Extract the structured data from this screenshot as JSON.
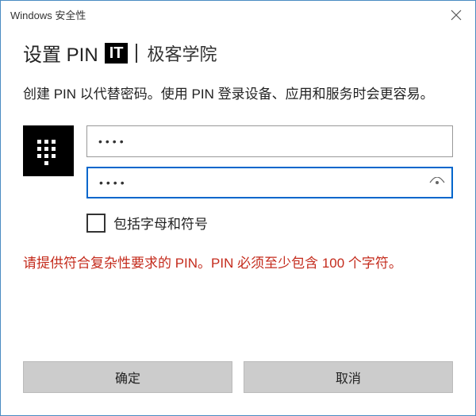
{
  "titlebar": {
    "title": "Windows 安全性"
  },
  "heading": "设置 PIN",
  "brand": {
    "badge": "IT",
    "text": "极客学院"
  },
  "description": "创建 PIN 以代替密码。使用 PIN 登录设备、应用和服务时会更容易。",
  "pin": {
    "value1": "••••",
    "value2": "••••"
  },
  "checkbox": {
    "label": "包括字母和符号",
    "checked": false
  },
  "error": "请提供符合复杂性要求的 PIN。PIN 必须至少包含 100 个字符。",
  "buttons": {
    "ok": "确定",
    "cancel": "取消"
  }
}
